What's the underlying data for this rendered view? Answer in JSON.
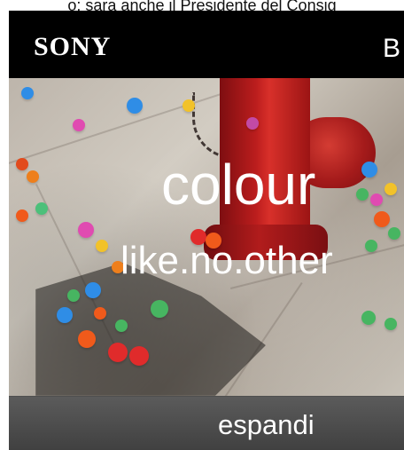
{
  "top_text": "o: sara anche il Presidente del Consig",
  "ad": {
    "brand": {
      "logo_text": "SONY",
      "right_text": "B"
    },
    "hero": {
      "headline": "colour",
      "subline": "like.no.other"
    },
    "expand_button": {
      "label": "espandi"
    },
    "colors": {
      "background": "#000000",
      "expand_bar": "#4f4f4f",
      "headline_text": "#ffffff",
      "hydrant_red": "#bb1d1d"
    }
  }
}
